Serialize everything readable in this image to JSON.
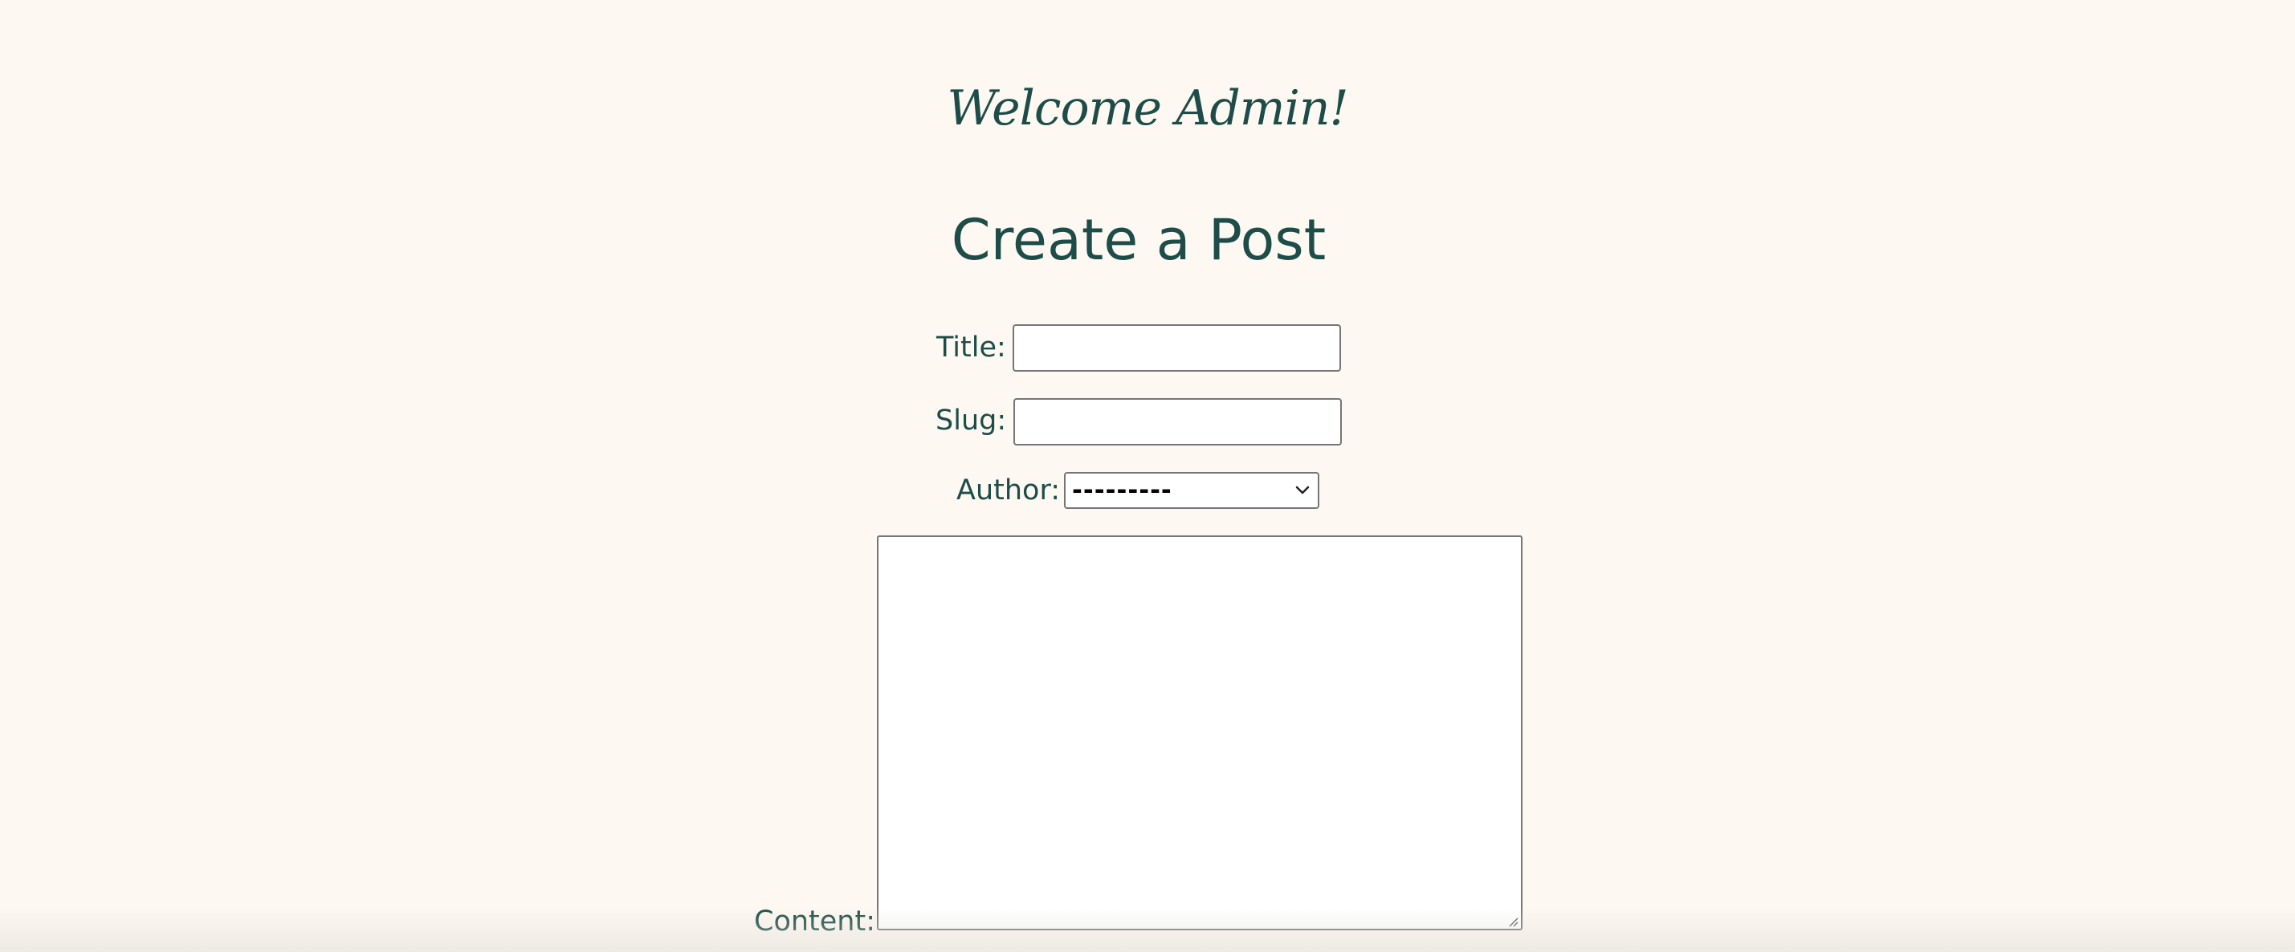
{
  "header": {
    "welcome": "Welcome Admin!"
  },
  "page": {
    "title": "Create a Post"
  },
  "form": {
    "title_label": "Title:",
    "title_value": "",
    "slug_label": "Slug:",
    "slug_value": "",
    "author_label": "Author:",
    "author_selected": "---------",
    "content_label": "Content:",
    "content_value": ""
  },
  "icons": {
    "dropdown": "chevron-down-icon",
    "resize": "resize-grip-icon"
  },
  "colors": {
    "background": "#fdf8f1",
    "text": "#1e4d49",
    "input_border": "#767676"
  }
}
